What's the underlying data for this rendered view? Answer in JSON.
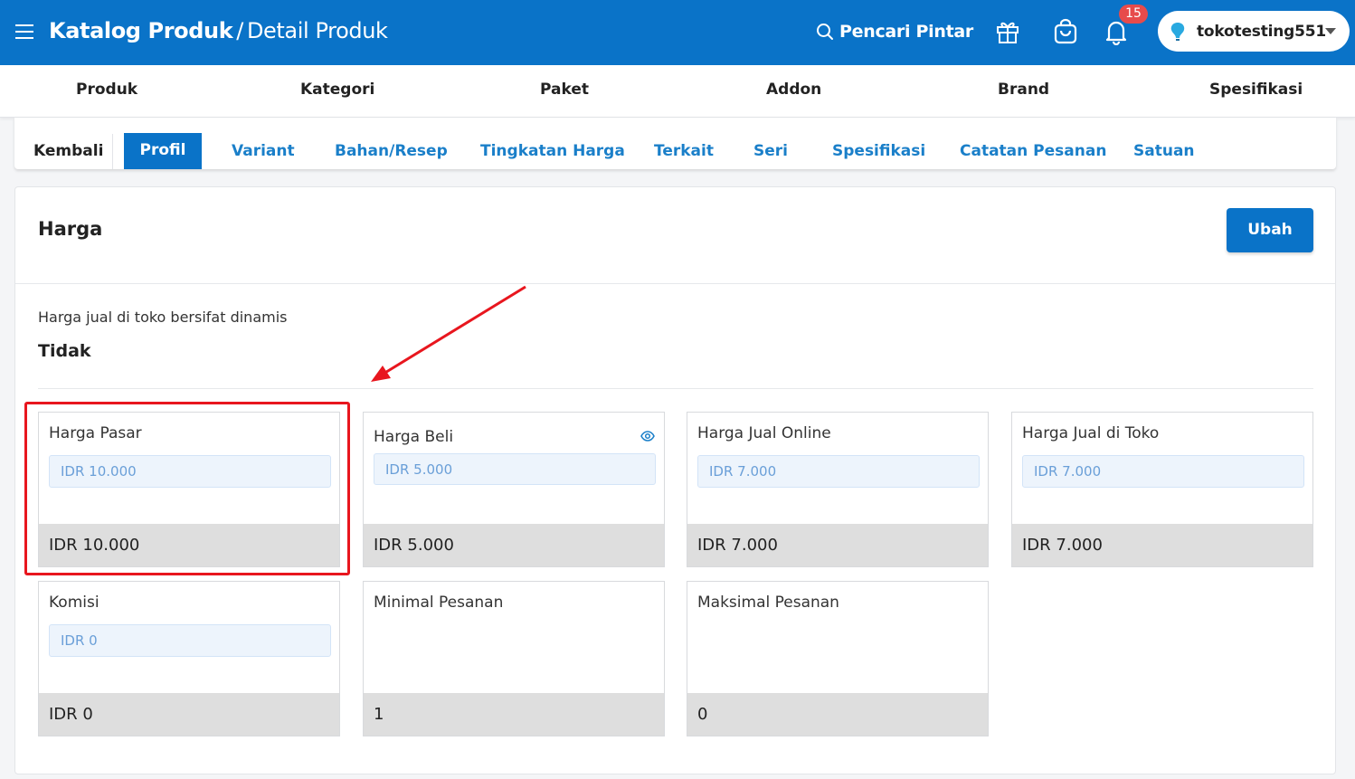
{
  "header": {
    "crumb_main": "Katalog Produk",
    "crumb_sep": "/",
    "crumb_sub": "Detail Produk",
    "smart_search": "Pencari Pintar",
    "notif_count": "15",
    "store_name": "tokotesting551"
  },
  "catnav": [
    "Produk",
    "Kategori",
    "Paket",
    "Addon",
    "Brand",
    "Spesifikasi"
  ],
  "subtabs": {
    "back": "Kembali",
    "active": "Profil",
    "items": [
      "Variant",
      "Bahan/Resep",
      "Tingkatan Harga",
      "Terkait",
      "Seri",
      "Spesifikasi",
      "Catatan Pesanan",
      "Satuan"
    ]
  },
  "card": {
    "title": "Harga",
    "edit_button": "Ubah",
    "dynamic_label": "Harga jual di toko bersifat dinamis",
    "dynamic_value": "Tidak"
  },
  "prices": [
    {
      "label": "Harga Pasar",
      "input": "IDR 10.000",
      "value": "IDR 10.000"
    },
    {
      "label": "Harga Beli",
      "input": "IDR 5.000",
      "value": "IDR 5.000"
    },
    {
      "label": "Harga Jual Online",
      "input": "IDR 7.000",
      "value": "IDR 7.000"
    },
    {
      "label": "Harga Jual di Toko",
      "input": "IDR 7.000",
      "value": "IDR 7.000"
    },
    {
      "label": "Komisi",
      "input": "IDR 0",
      "value": "IDR 0"
    },
    {
      "label": "Minimal Pesanan",
      "value": "1"
    },
    {
      "label": "Maksimal Pesanan",
      "value": "0"
    }
  ],
  "colors": {
    "primary": "#0a73c8",
    "tab_text": "#1a7fc9",
    "annotation": "#e8161e",
    "badge": "#e74b4b"
  }
}
